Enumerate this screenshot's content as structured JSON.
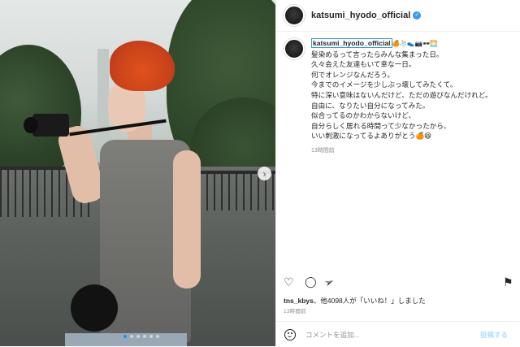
{
  "post": {
    "username": "katsumi_hyodo_official",
    "caption_user": "katsumi_hyodo_official",
    "caption_emojis": "🍊🧦👟📷🕶🌅",
    "caption_lines": [
      "髪染めるって言ったらみんな集まった日。",
      "久々会えた友達もいて幸な一日。",
      "何でオレンジなんだろう。",
      "今までのイメージを少しぶっ壊してみたくて。",
      "特に深い意味はないんだけど、ただの遊びなんだけれど。",
      "自由に、なりたい自分になってみた。",
      "似合ってるのかわからないけど、",
      "自分らしく居れる時間って少なかったから、",
      "いい刺激になってるよありがとう🍊😆"
    ],
    "time_ago": "13時間前",
    "likes_user": "tns_kbys",
    "likes_text": "、他4098人が「いいね！」しました",
    "timestamp": "13時間前"
  },
  "comment": {
    "placeholder": "コメントを追加...",
    "post_label": "投稿する"
  },
  "icons": {
    "next": "›",
    "like": "♡",
    "comment": "◯",
    "share": "➢",
    "bookmark": "⚑"
  },
  "colors": {
    "accent": "#3897f0",
    "post_disabled": "#b2dffc"
  }
}
